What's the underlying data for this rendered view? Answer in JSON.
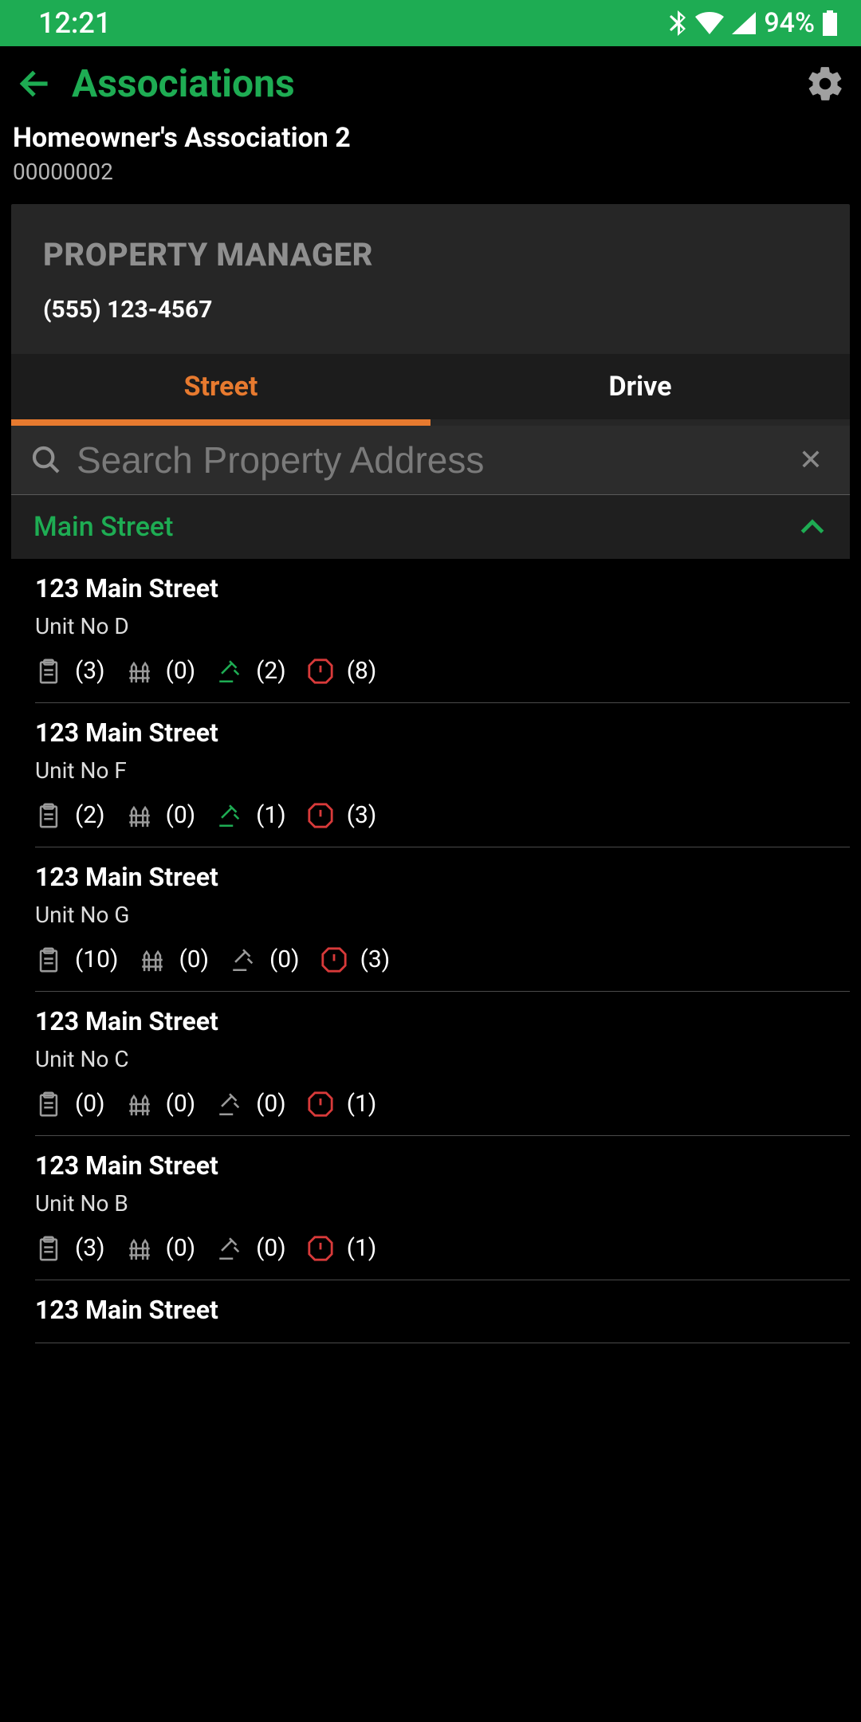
{
  "status": {
    "time": "12:21",
    "battery": "94%"
  },
  "header": {
    "title": "Associations"
  },
  "association": {
    "name": "Homeowner's Association 2",
    "id": "00000002"
  },
  "pm": {
    "label": "PROPERTY MANAGER",
    "phone": "(555) 123-4567"
  },
  "tabs": {
    "street": "Street",
    "drive": "Drive"
  },
  "search": {
    "placeholder": "Search Property Address"
  },
  "section": {
    "title": "Main Street"
  },
  "props": [
    {
      "addr": "123 Main Street",
      "unit": "Unit No D",
      "clip": "(3)",
      "fence": "(0)",
      "gavel": "(2)",
      "gavel_cls": "ic-green",
      "alert": "(8)"
    },
    {
      "addr": "123 Main Street",
      "unit": "Unit No F",
      "clip": "(2)",
      "fence": "(0)",
      "gavel": "(1)",
      "gavel_cls": "ic-green",
      "alert": "(3)"
    },
    {
      "addr": "123 Main Street",
      "unit": "Unit No G",
      "clip": "(10)",
      "fence": "(0)",
      "gavel": "(0)",
      "gavel_cls": "ic-gray",
      "alert": "(3)"
    },
    {
      "addr": "123 Main Street",
      "unit": "Unit No C",
      "clip": "(0)",
      "fence": "(0)",
      "gavel": "(0)",
      "gavel_cls": "ic-gray",
      "alert": "(1)"
    },
    {
      "addr": "123 Main Street",
      "unit": "Unit No B",
      "clip": "(3)",
      "fence": "(0)",
      "gavel": "(0)",
      "gavel_cls": "ic-gray",
      "alert": "(1)"
    },
    {
      "addr": "123 Main Street",
      "unit": "",
      "clip": "",
      "fence": "",
      "gavel": "",
      "gavel_cls": "ic-gray",
      "alert": ""
    }
  ]
}
